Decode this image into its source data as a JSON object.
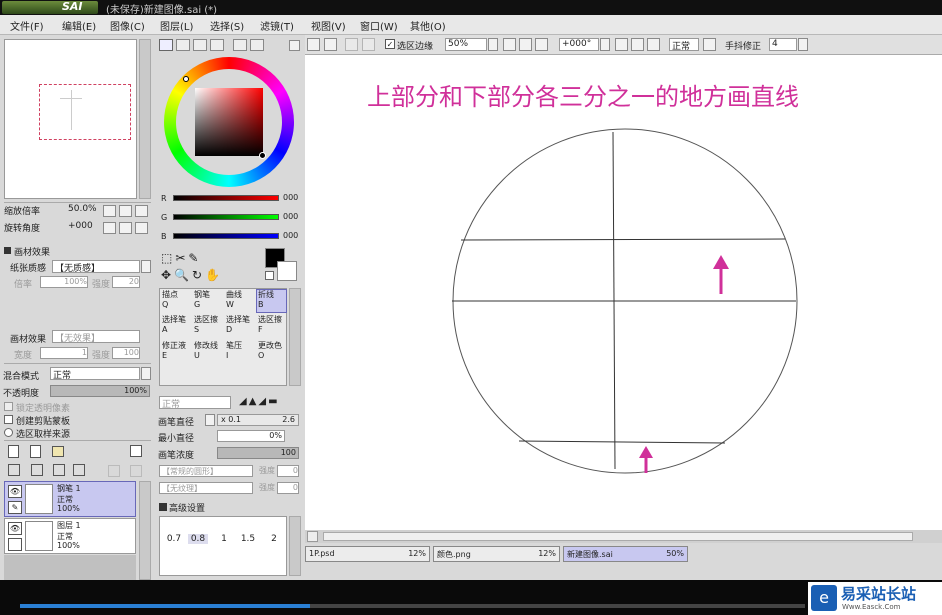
{
  "titlebar": {
    "logo_text": "SAI",
    "title": "(未保存)新建图像.sai (*)"
  },
  "menu": [
    "文件(F)",
    "编辑(E)",
    "图像(C)",
    "图层(L)",
    "选择(S)",
    "滤镜(T)",
    "视图(V)",
    "窗口(W)",
    "其他(O)"
  ],
  "navigator": {
    "zoom_label": "缩放倍率",
    "zoom_value": "50.0%",
    "rotate_label": "旋转角度",
    "rotate_value": "+000"
  },
  "paper": {
    "header": "画材效果",
    "texture_label": "纸张质感",
    "texture_value": "【无质感】",
    "scale_label": "倍率",
    "scale_value": "100%",
    "strength_label": "强度",
    "strength_value": "20",
    "effect_label": "画材效果",
    "effect_value": "【无效果】",
    "width_label": "宽度",
    "width_value": "1",
    "strength2_label": "强度",
    "strength2_value": "100"
  },
  "layer_props": {
    "blend_label": "混合模式",
    "blend_value": "正常",
    "opacity_label": "不透明度",
    "opacity_value": "100%",
    "lock_label": "锁定透明像素",
    "clip_label": "创建剪贴蒙板",
    "source_label": "选区取样来源"
  },
  "layers": [
    {
      "name": "钢笔 1",
      "mode": "正常",
      "opacity": "100%",
      "selected": true
    },
    {
      "name": "图层 1",
      "mode": "正常",
      "opacity": "100%",
      "selected": false
    }
  ],
  "rgb": {
    "r_label": "R",
    "r_value": "000",
    "g_label": "G",
    "g_value": "000",
    "b_label": "B",
    "b_value": "000"
  },
  "colors": {
    "primary": "#000000",
    "secondary": "#ffffff",
    "accent": "#d0309a",
    "selected_layer": "#c8c8f0"
  },
  "tools": [
    {
      "label": "描点",
      "key": "Q"
    },
    {
      "label": "钢笔",
      "key": "G"
    },
    {
      "label": "曲线",
      "key": "W"
    },
    {
      "label": "折线",
      "key": "B"
    },
    {
      "label": "选择笔",
      "key": "A"
    },
    {
      "label": "选区擦",
      "key": "S"
    },
    {
      "label": "选择笔",
      "key": "D"
    },
    {
      "label": "选区擦",
      "key": "F"
    },
    {
      "label": "修正液",
      "key": "E"
    },
    {
      "label": "修改线",
      "key": "U"
    },
    {
      "label": "笔压",
      "key": "I"
    },
    {
      "label": "更改色",
      "key": "O"
    }
  ],
  "brush": {
    "mode_value": "正常",
    "size_label": "画笔直径",
    "size_mult": "x 0.1",
    "size_value": "2.6",
    "min_size_label": "最小直径",
    "min_size_value": "0%",
    "density_label": "画笔浓度",
    "density_value": "100",
    "shape_value": "【常规的圆形】",
    "shape_strength": "强度",
    "shape_strength_value": "0",
    "texture_value": "【无纹理】",
    "texture_strength": "强度",
    "texture_strength_value": "0",
    "advanced_label": "高级设置",
    "sizes": [
      "0.7",
      "0.8",
      "1",
      "1.5",
      "2"
    ]
  },
  "toolbar": {
    "select_edge_label": "选区边缘",
    "zoom_value": "50%",
    "angle_value": "+000°",
    "mode_value": "正常",
    "stabilizer_label": "手抖修正",
    "stabilizer_value": "4"
  },
  "canvas": {
    "annotation": "上部分和下部分各三分之一的地方画直线"
  },
  "tabs": [
    {
      "name": "1P.psd",
      "zoom": "12%",
      "selected": false
    },
    {
      "name": "颜色.png",
      "zoom": "12%",
      "selected": false
    },
    {
      "name": "新建图像.sai",
      "zoom": "50%",
      "selected": true
    }
  ],
  "watermark": {
    "name": "易采站长站",
    "url": "Www.Easck.Com"
  },
  "video": {
    "progress": 0.37
  }
}
